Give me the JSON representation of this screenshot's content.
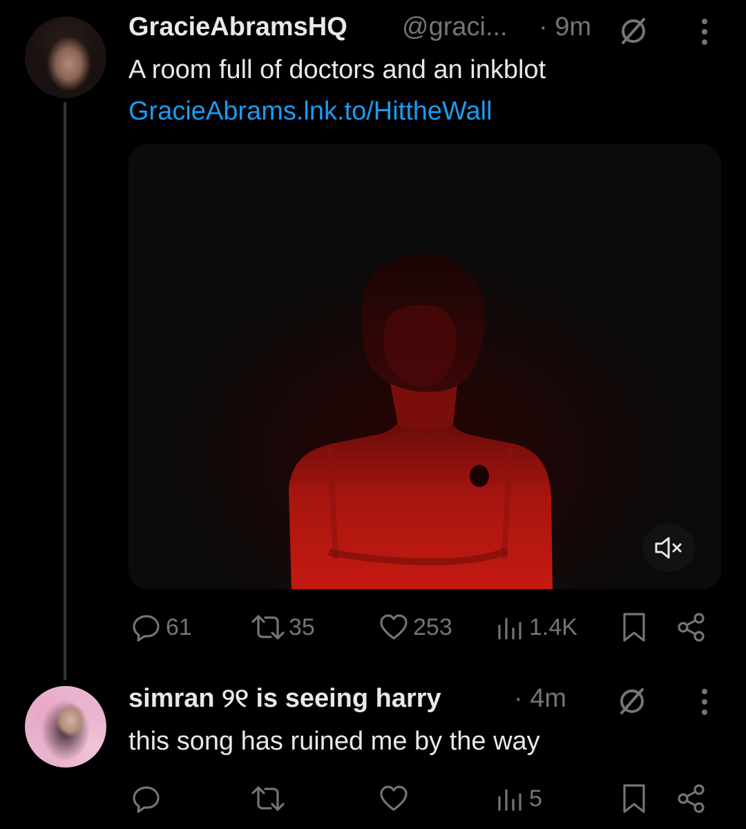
{
  "colors": {
    "background": "#000000",
    "primary_text": "#e7e9ea",
    "secondary_text": "#71767b",
    "link": "#1d9bf0",
    "thread_line": "#333639"
  },
  "posts": [
    {
      "display_name": "GracieAbramsHQ",
      "handle": "@graci...",
      "time": "· 9m",
      "text": "A room full of doctors and an inkblot",
      "link": "GracieAbrams.lnk.to/HittheWall",
      "media": {
        "type": "video",
        "muted": true,
        "mute_icon": "speaker-muted-icon"
      },
      "stats": {
        "replies": "61",
        "reposts": "35",
        "likes": "253",
        "views": "1.4K"
      }
    },
    {
      "display_name": "simran ୨୧ is seeing harry",
      "time": "· 4m",
      "text": "this song has ruined me by the way",
      "stats": {
        "replies": "",
        "reposts": "",
        "likes": "",
        "views": "5"
      }
    }
  ],
  "icons": [
    "reply-icon",
    "repost-icon",
    "like-icon",
    "views-icon",
    "bookmark-icon",
    "share-icon",
    "more-icon",
    "not-interested-icon"
  ]
}
